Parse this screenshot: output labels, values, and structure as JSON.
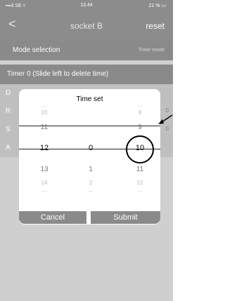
{
  "status": {
    "carrier": "▪▪▪3 SE ▿",
    "time": "13.44",
    "battery": "21 % ▭"
  },
  "nav": {
    "back": "<",
    "title": "socket B",
    "reset": "reset"
  },
  "mode": {
    "label": "Mode selection",
    "value": "Timer mode"
  },
  "timer_header": "Timer 0 (Slide left to delete time)",
  "bg_rows": [
    {
      "label": "D",
      "value": ""
    },
    {
      "label": "R",
      "value": "0"
    },
    {
      "label": "S",
      "value": "0"
    },
    {
      "label": "A",
      "value": ""
    }
  ],
  "dialog": {
    "title": "Time set",
    "cancel": "Cancel",
    "submit": "Submit",
    "columns": [
      {
        "items": [
          "...",
          "10",
          "11",
          "12",
          "13",
          "14",
          "..."
        ],
        "selected": "12"
      },
      {
        "items": [
          "",
          "",
          "",
          "0",
          "1",
          "2",
          "..."
        ],
        "selected": "0"
      },
      {
        "items": [
          "...",
          "8",
          "9",
          "10",
          "11",
          "12",
          "..."
        ],
        "selected": "10"
      }
    ]
  }
}
